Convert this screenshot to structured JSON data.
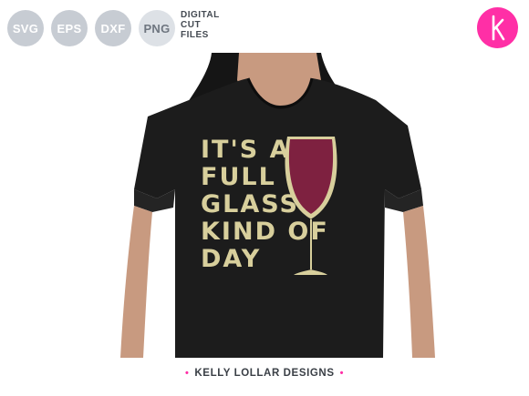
{
  "formats": [
    "SVG",
    "EPS",
    "DXF",
    "PNG"
  ],
  "cut_files_label": [
    "DIGITAL",
    "CUT",
    "FILES"
  ],
  "logo_letter": "k",
  "design_lines": [
    "IT'S A",
    "FULL",
    "GLASS",
    "KIND OF",
    "DAY"
  ],
  "footer": {
    "text": "KELLY LOLLAR DESIGNS",
    "bullet": "•"
  },
  "colors": {
    "brand_pink": "#ff2fa6",
    "shirt": "#1c1c1c",
    "wine": "#7e2140",
    "gold": "#d8cf9c",
    "skin": "#c89a80"
  }
}
